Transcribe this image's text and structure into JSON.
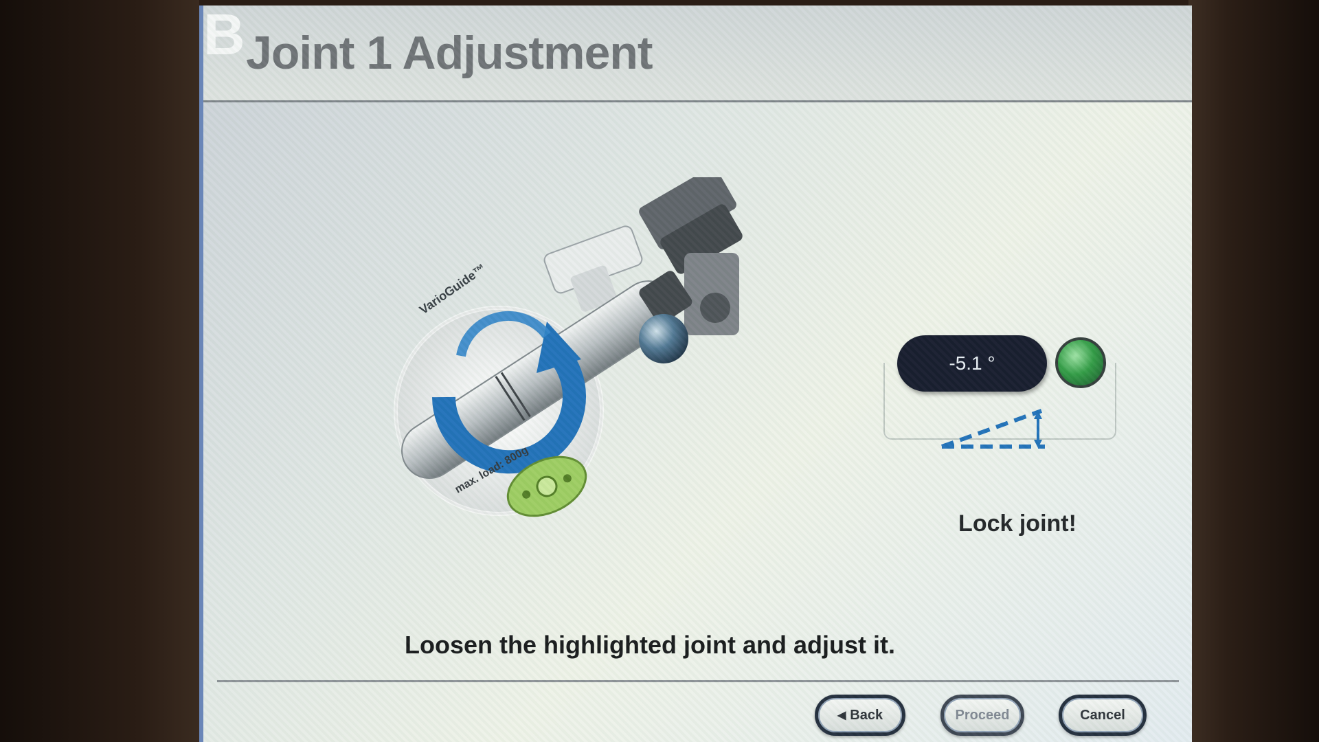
{
  "header": {
    "logo_letter": "B",
    "title": "Joint 1 Adjustment"
  },
  "readout": {
    "value": "-5.1 °",
    "status_color": "#2f9a43"
  },
  "status": {
    "lock_label": "Lock joint!"
  },
  "instruction": "Loosen the highlighted joint and adjust it.",
  "illustration": {
    "brand_label": "VarioGuide™",
    "caution_label": "max. load: 800g"
  },
  "buttons": {
    "back": "Back",
    "proceed": "Proceed",
    "cancel": "Cancel"
  },
  "colors": {
    "accent_blue": "#1e6fb8",
    "status_green": "#2f9a43",
    "readout_bg": "#13182a"
  }
}
